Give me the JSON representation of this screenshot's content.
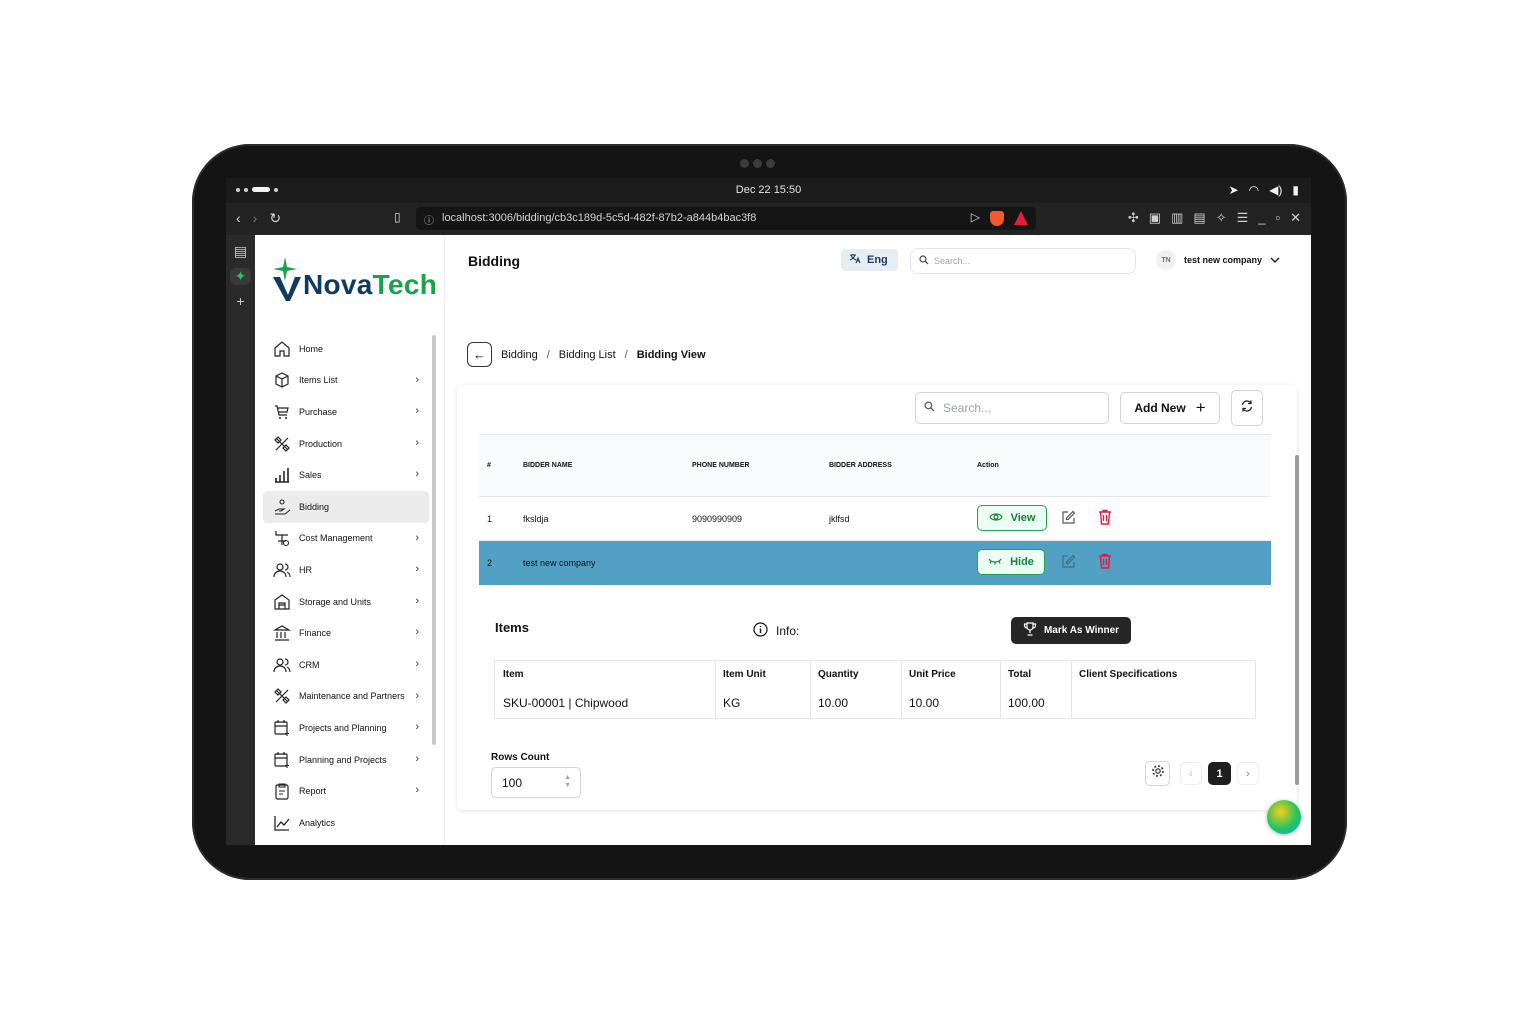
{
  "os": {
    "clock": "Dec 22  15:50"
  },
  "browser": {
    "url": "localhost:3006/bidding/cb3c189d-5c5d-482f-87b2-a844b4bac3f8"
  },
  "brand": {
    "prefix": "Nova",
    "suffix": "Tech"
  },
  "sidebar": {
    "items": [
      {
        "label": "Home",
        "icon": "home-icon"
      },
      {
        "label": "Items List",
        "icon": "box-icon"
      },
      {
        "label": "Purchase",
        "icon": "cart-icon"
      },
      {
        "label": "Production",
        "icon": "tools-icon"
      },
      {
        "label": "Sales",
        "icon": "bar-chart-icon"
      },
      {
        "label": "Bidding",
        "icon": "hand-coin-icon"
      },
      {
        "label": "Cost Management",
        "icon": "cost-icon"
      },
      {
        "label": "HR",
        "icon": "people-icon"
      },
      {
        "label": "Storage and Units",
        "icon": "warehouse-icon"
      },
      {
        "label": "Finance",
        "icon": "bank-icon"
      },
      {
        "label": "CRM",
        "icon": "people-icon"
      },
      {
        "label": "Maintenance and Partners",
        "icon": "tools-icon"
      },
      {
        "label": "Projects and Planning",
        "icon": "calendar-icon"
      },
      {
        "label": "Planning and Projects",
        "icon": "calendar-icon"
      },
      {
        "label": "Report",
        "icon": "clipboard-icon"
      },
      {
        "label": "Analytics",
        "icon": "line-chart-icon"
      }
    ]
  },
  "header": {
    "title": "Bidding",
    "lang": "Eng",
    "search_placeholder": "Search...",
    "user_initials": "TN",
    "user_name": "test new company"
  },
  "breadcrumb": {
    "a": "Bidding",
    "b": "Bidding List",
    "c": "Bidding View",
    "sep": "/"
  },
  "toolbar": {
    "search_placeholder": "Search...",
    "add_new": "Add New"
  },
  "table": {
    "headers": {
      "num": "#",
      "name": "BIDDER NAME",
      "phone": "PHONE NUMBER",
      "address": "BIDDER ADDRESS",
      "action": "Action"
    },
    "rows": [
      {
        "num": "1",
        "name": "fksldja",
        "phone": "9090990909",
        "address": "jklfsd",
        "button": "View"
      },
      {
        "num": "2",
        "name": "test new company",
        "phone": "",
        "address": "",
        "button": "Hide"
      }
    ]
  },
  "items": {
    "title": "Items",
    "info": "Info:",
    "winner": "Mark As Winner",
    "headers": {
      "item": "Item",
      "unit": "Item Unit",
      "qty": "Quantity",
      "price": "Unit Price",
      "total": "Total",
      "spec": "Client Specifications"
    },
    "row": {
      "item": "SKU-00001 | Chipwood",
      "unit": "KG",
      "qty": "10.00",
      "price": "10.00",
      "total": "100.00",
      "spec": ""
    }
  },
  "footer": {
    "rows_label": "Rows Count",
    "rows_value": "100",
    "page": "1"
  },
  "colors": {
    "accent_green": "#16a34a",
    "brand_navy": "#0f3b5f",
    "selected_row": "#52a0c3",
    "delete_red": "#e11d48"
  }
}
